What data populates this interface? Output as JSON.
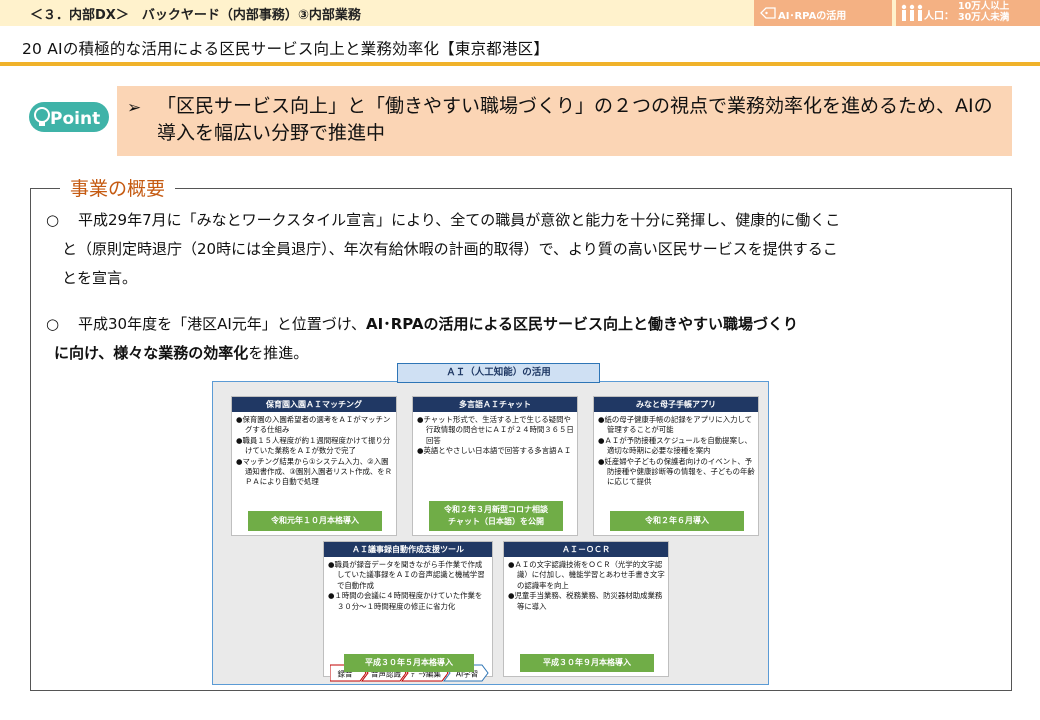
{
  "header": {
    "breadcrumb": "＜３．内部DX＞　バックヤード（内部事務）③内部業務",
    "tag_ai": "AI･RPAの活用",
    "pop_label": "人口：",
    "pop_line1": "10万人以上",
    "pop_line2": "30万人未満",
    "tag_color": "#f4b183",
    "bar_color": "#fff2cc"
  },
  "title": "20  AIの積極的な活用による区民サービス向上と業務効率化【東京都港区】",
  "point": {
    "logo_text": "Point",
    "arrow": "➢",
    "text": "「区民サービス向上」と「働きやすい職場づくり」の２つの視点で業務効率化を進めるため、AIの導入を幅広い分野で推進中"
  },
  "overview": {
    "title": "事業の概要",
    "p1_bullet": "○",
    "p1_line1": "平成29年7月に「みなとワークスタイル宣言」により、全ての職員が意欲と能力を十分に発揮し、健康的に働くこ",
    "p1_line2": "と（原則定時退庁（20時には全員退庁）、年次有給休暇の計画的取得）で、より質の高い区民サービスを提供するこ",
    "p1_line3": "とを宣言。",
    "p2_bullet": "○",
    "p2_pre": "平成30年度を「港区AI元年」と位置づけ、",
    "p2_bold1": "AI･RPAの活用による区民サービス向上と働きやすい職場づくり",
    "p2_bold2": "に向け、様々な業務の効率化",
    "p2_post": "を推進。"
  },
  "diagram": {
    "banner": "ＡＩ（人工知能）の活用",
    "cards": [
      {
        "title": "保育園入園ＡＩマッチング",
        "items": [
          "●保育園の入園希望者の選考をＡＩがマッチングする仕組み",
          "●職員１５人程度が約１週間程度かけて振り分けていた業務をＡＩが数分で完了",
          "●マッチング結果から①システム入力、②入園通知書作成、③園別入園者リスト作成、をＲＰＡにより自動で処理"
        ],
        "footer": "令和元年１０月本格導入"
      },
      {
        "title": "多言語ＡＩチャット",
        "items": [
          "●チャット形式で、生活する上で生じる疑問や行政情報の問合せにＡＩが２４時間３６５日回答",
          "●英語とやさしい日本語で回答する多言語ＡＩ"
        ],
        "footer_line1": "令和２年３月新型コロナ相談",
        "footer_line2": "チャット（日本語）を公開"
      },
      {
        "title": "みなと母子手帳アプリ",
        "items": [
          "●紙の母子健康手帳の記録をアプリに入力して管理することが可能",
          "●ＡＩが予防接種スケジュールを自動提案し、適切な時期に必要な接種を案内",
          "●妊産婦や子どもの保護者向けのイベント、予防接種や健康診断等の情報を、子どもの年齢に応じて提供"
        ],
        "footer": "令和２年６月導入"
      },
      {
        "title": "ＡＩ議事録自動作成支援ツール",
        "items": [
          "●職員が録音データを聞きながら手作業で作成していた議事録をＡＩの音声認識と機械学習で自動作成",
          "●１時間の会議に４時間程度かけていた作業を３０分～１時間程度の修正に省力化"
        ],
        "flow": [
          "録音",
          "音声認識",
          "ﾃﾞｰﾀ編集",
          "AI学習"
        ],
        "footer": "平成３０年５月本格導入"
      },
      {
        "title": "ＡＩ－ＯＣＲ",
        "items": [
          "●ＡＩの文字認識技術をＯＣＲ（光学的文字認識）に付加し、機能学習とあわせ手書き文字の認識率を向上",
          "●児童手当業務、税務業務、防災器材助成業務等に導入"
        ],
        "footer": "平成３０年９月本格導入"
      }
    ]
  }
}
